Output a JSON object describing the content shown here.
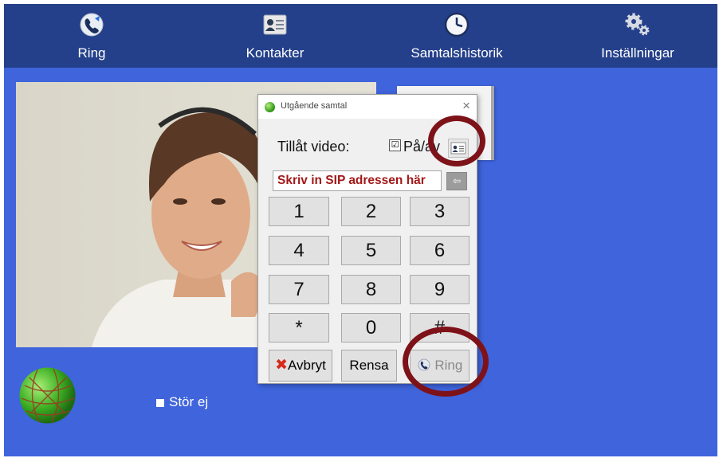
{
  "nav": {
    "items": [
      {
        "label": "Ring",
        "icon": "phone-globe-icon"
      },
      {
        "label": "Kontakter",
        "icon": "contact-card-icon"
      },
      {
        "label": "Samtalshistorik",
        "icon": "clock-icon"
      },
      {
        "label": "Inställningar",
        "icon": "gears-icon"
      }
    ]
  },
  "dialog": {
    "title": "Utgående samtal",
    "close_label": "×",
    "video_label": "Tillåt video:",
    "video_checked": true,
    "video_check_glyph": "☑",
    "video_toggle_label": "På/av",
    "sip_placeholder": "Skriv in SIP adressen här",
    "back_label": "⇦",
    "keys": [
      "1",
      "2",
      "3",
      "4",
      "5",
      "6",
      "7",
      "8",
      "9",
      "*",
      "0",
      "#"
    ],
    "cancel_label": "Avbryt",
    "clear_label": "Rensa",
    "call_label": "Ring"
  },
  "status": {
    "dnd_label": "Stör ej",
    "dnd_checked": false
  },
  "colors": {
    "background": "#3f64dc",
    "navbar": "#24408a",
    "sip_text": "#a31818",
    "highlight_ring": "#7e1219"
  }
}
